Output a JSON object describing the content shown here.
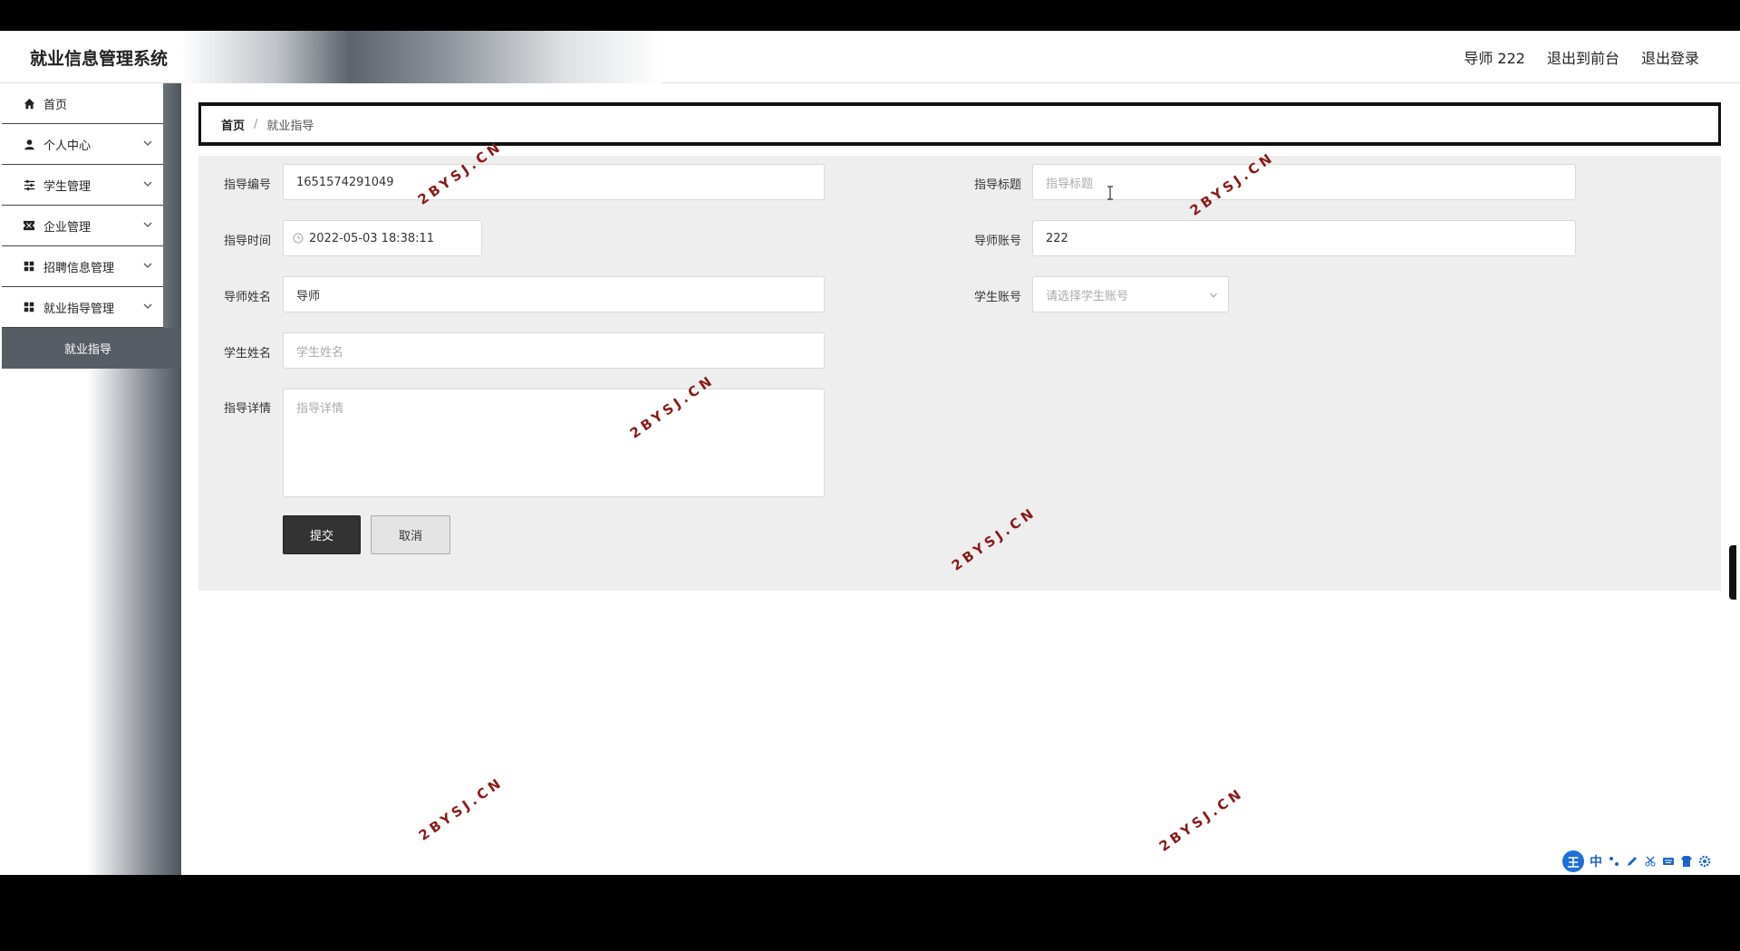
{
  "header": {
    "app_title": "就业信息管理系统",
    "user_label": "导师 222",
    "to_front_label": "退出到前台",
    "logout_label": "退出登录"
  },
  "sidebar": {
    "items": [
      {
        "label": "首页",
        "icon": "home-icon"
      },
      {
        "label": "个人中心",
        "icon": "user-icon"
      },
      {
        "label": "学生管理",
        "icon": "sliders-icon"
      },
      {
        "label": "企业管理",
        "icon": "ticket-icon"
      },
      {
        "label": "招聘信息管理",
        "icon": "grid-icon"
      },
      {
        "label": "就业指导管理",
        "icon": "grid-icon"
      }
    ],
    "active_sub": "就业指导"
  },
  "breadcrumb": {
    "home": "首页",
    "separator": "/",
    "current": "就业指导"
  },
  "form": {
    "code_label": "指导编号",
    "code_value": "1651574291049",
    "title_label": "指导标题",
    "title_placeholder": "指导标题",
    "time_label": "指导时间",
    "time_value": "2022-05-03 18:38:11",
    "teacher_account_label": "导师账号",
    "teacher_account_value": "222",
    "teacher_name_label": "导师姓名",
    "teacher_name_value": "导师",
    "student_account_label": "学生账号",
    "student_account_placeholder": "请选择学生账号",
    "student_name_label": "学生姓名",
    "student_name_placeholder": "学生姓名",
    "detail_label": "指导详情",
    "detail_placeholder": "指导详情",
    "submit_label": "提交",
    "cancel_label": "取消"
  },
  "watermark": "2BYSJ.CN",
  "ime": {
    "logo": "王",
    "mode": "中"
  },
  "colors": {
    "active_menu": "#575d65",
    "submit_button": "#333333",
    "watermark": "#8b1a1a"
  }
}
